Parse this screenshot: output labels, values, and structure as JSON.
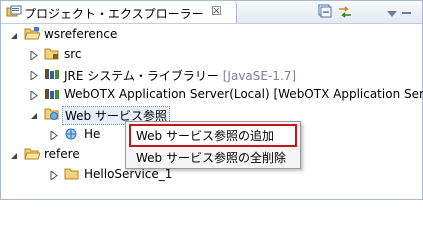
{
  "view": {
    "tab_title": "プロジェクト・エクスプローラー",
    "close_glyph": "☒",
    "toolbar": {
      "collapse_all": "collapse-all-icon",
      "link_editor": "link-with-editor-icon",
      "view_menu": "view-menu-icon"
    }
  },
  "tree": {
    "items": [
      {
        "label": "wsreference"
      },
      {
        "label": "src"
      },
      {
        "label": "JRE システム・ライブラリー",
        "suffix": "[JavaSE-1.7]"
      },
      {
        "label": "WebOTX Application Server(Local) [WebOTX Application Server]"
      },
      {
        "label": "Web サービス参照"
      },
      {
        "label": "He"
      },
      {
        "label": "refere"
      },
      {
        "label": "HelloService_1"
      }
    ]
  },
  "context_menu": {
    "items": [
      {
        "label": "Web サービス参照の追加"
      },
      {
        "label": "Web サービス参照の全削除"
      }
    ]
  },
  "colors": {
    "accent": "#c0181c",
    "gray_text": "#7f7f9f",
    "border": "#a9b8cf"
  }
}
